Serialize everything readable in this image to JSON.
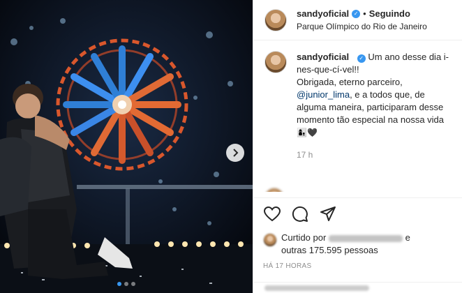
{
  "post": {
    "username": "sandyoficial",
    "follow_status": "Seguindo",
    "location": "Parque Olímpico do Rio de Janeiro"
  },
  "caption": {
    "username": "sandyoficial",
    "text_1": "Um ano desse dia i-nes-que-cí-vel!!",
    "text_2": "Obrigada, eterno parceiro,",
    "mention": "@junior_lima",
    "text_3": ", e a todos que, de alguma maneira, participaram desse momento tão especial na nossa vida",
    "emoji": "👩‍👦🖤",
    "time": "17 h"
  },
  "likes": {
    "prefix": "Curtido por",
    "suffix": "e",
    "count_text": "outras 175.595 pessoas"
  },
  "post_age": "HÁ 17 HORAS",
  "icons": {
    "like": "heart-icon",
    "comment": "comment-bubble-icon",
    "share": "paper-plane-icon",
    "verified": "verified-badge-icon",
    "next": "chevron-right-icon"
  },
  "carousel": {
    "slides": 3,
    "active": 1
  },
  "colors": {
    "accent": "#3897f0",
    "mention": "#00376b",
    "muted": "#8e8e8e"
  }
}
